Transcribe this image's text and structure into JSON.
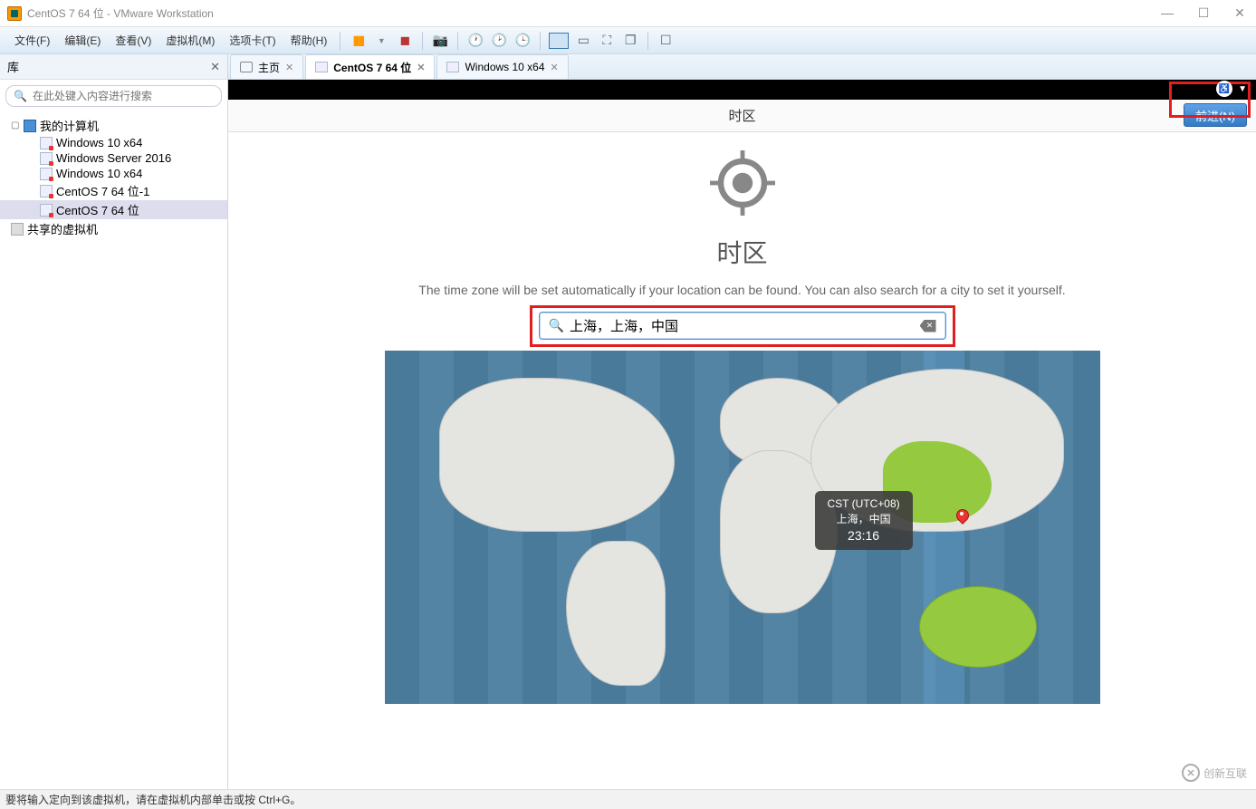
{
  "window": {
    "title": "CentOS 7 64 位 - VMware Workstation"
  },
  "menu": {
    "file": "文件(F)",
    "edit": "编辑(E)",
    "view": "查看(V)",
    "vm": "虚拟机(M)",
    "tabs": "选项卡(T)",
    "help": "帮助(H)"
  },
  "sidebar": {
    "header": "库",
    "search_placeholder": "在此处键入内容进行搜索",
    "root": "我的计算机",
    "items": [
      "Windows 10 x64",
      "Windows Server 2016",
      "Windows 10 x64",
      "CentOS 7 64 位-1",
      "CentOS 7 64 位"
    ],
    "shared": "共享的虚拟机"
  },
  "tabs": {
    "home": "主页",
    "t1": "CentOS 7 64 位",
    "t2": "Windows 10 x64"
  },
  "guest": {
    "header_title": "时区",
    "next_button": "前进(N)",
    "heading": "时区",
    "subtext": "The time zone will be set automatically if your location can be found. You can also search for a city to set it yourself.",
    "search_value": "上海，上海，中国",
    "tooltip_tz": "CST (UTC+08)",
    "tooltip_loc": "上海，中国",
    "tooltip_time": "23:16"
  },
  "statusbar": {
    "text": "要将输入定向到该虚拟机，请在虚拟机内部单击或按 Ctrl+G。"
  },
  "watermark": "创新互联"
}
